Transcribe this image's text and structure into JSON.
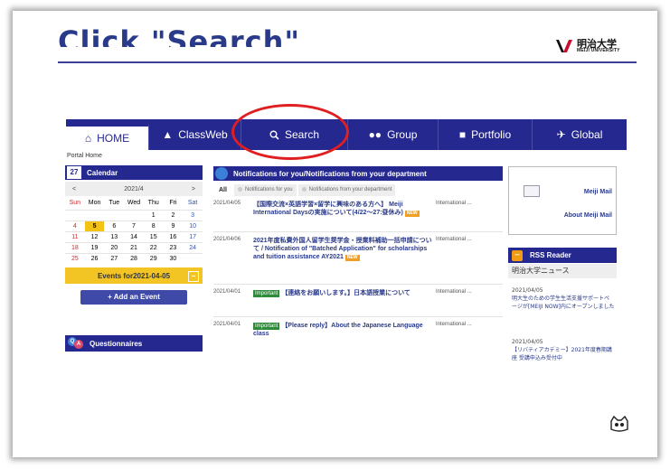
{
  "slide": {
    "title": "Click \"Search\""
  },
  "logo": {
    "jp": "明治大学",
    "en": "MEIJI UNIVERSITY"
  },
  "nav": {
    "items": [
      {
        "label": "HOME",
        "icon": "home-icon"
      },
      {
        "label": "ClassWeb",
        "icon": "mortarboard-icon"
      },
      {
        "label": "Search",
        "icon": "search-icon"
      },
      {
        "label": "Group",
        "icon": "group-icon"
      },
      {
        "label": "Portfolio",
        "icon": "folder-icon"
      },
      {
        "label": "Global",
        "icon": "airplane-icon"
      }
    ]
  },
  "breadcrumb": "Portal Home",
  "calendar": {
    "header": "Calendar",
    "badge": "27",
    "month": "2021/4",
    "prev": "<",
    "next": ">",
    "dows": [
      "Sun",
      "Mon",
      "Tue",
      "Wed",
      "Thu",
      "Fri",
      "Sat"
    ],
    "weeks": [
      [
        "",
        "",
        "",
        "",
        "1",
        "2",
        "3"
      ],
      [
        "4",
        "5",
        "6",
        "7",
        "8",
        "9",
        "10"
      ],
      [
        "11",
        "12",
        "13",
        "14",
        "15",
        "16",
        "17"
      ],
      [
        "18",
        "19",
        "20",
        "21",
        "22",
        "23",
        "24"
      ],
      [
        "25",
        "26",
        "27",
        "28",
        "29",
        "30",
        ""
      ]
    ],
    "today": "5",
    "events_label": "Events for2021-04-05",
    "events_toggle": "−",
    "add_event": "+ Add an Event"
  },
  "questionnaires": {
    "label": "Questionnaires"
  },
  "notifications": {
    "header": "Notifications for you/Notifications from your department",
    "tabs": [
      "All",
      "Notifications for you",
      "Notifications from your department"
    ],
    "rows": [
      {
        "date": "2021/04/05",
        "title": "【国際交流×英語学習×留学に興味のある方へ】 Meiji International Daysの実施について(4/22〜27:昼休み)",
        "category": "International ...",
        "new": "NEW",
        "important": ""
      },
      {
        "date": "2021/04/06",
        "title": "2021年度私費外国人留学生奨学金・授業料補助一括申請について / Notification of \"Batched Application\" for scholarships and tuition assistance AY2021",
        "category": "International ...",
        "new": "NEW",
        "important": ""
      },
      {
        "date": "2021/04/01",
        "title": "【連絡をお願いします。】日本語授業について",
        "category": "International ...",
        "new": "",
        "important": "Important"
      },
      {
        "date": "2021/04/01",
        "title": "【Please reply】About the Japanese Language class",
        "category": "International ...",
        "new": "",
        "important": "Important"
      }
    ]
  },
  "mail": {
    "meiji_mail": "Meiji Mail",
    "about": "About Meiji Mail"
  },
  "rss": {
    "header": "RSS Reader",
    "sub": "明治大学ニュース",
    "items": [
      {
        "date": "2021/04/05",
        "title": "明大生のための学生生活支援サポートページが[MEIJI NOW]内にオープンしました"
      },
      {
        "date": "2021/04/05",
        "title": "【リバティアカデミー】2021年度春期講座 受講申込み受付中"
      }
    ]
  },
  "colors": {
    "nav": "#25288f",
    "highlight_oval": "#e02020",
    "today": "#f2c315",
    "important": "#2e8b3a",
    "new": "#f0a020"
  }
}
